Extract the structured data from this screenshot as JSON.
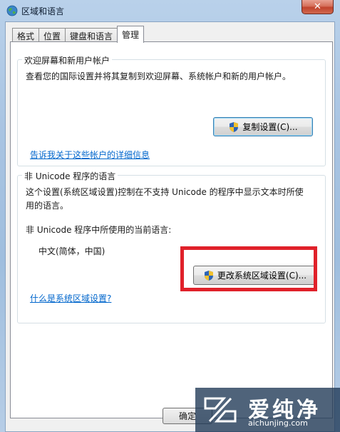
{
  "window": {
    "title": "区域和语言",
    "close_label": "✕"
  },
  "tabs": [
    {
      "label": "格式"
    },
    {
      "label": "位置"
    },
    {
      "label": "键盘和语言"
    },
    {
      "label": "管理",
      "active": true
    }
  ],
  "welcome_group": {
    "title": "欢迎屏幕和新用户帐户",
    "description": "查看您的国际设置并将其复制到欢迎屏幕、系统帐户和新的用户帐户。",
    "copy_button": "复制设置(C)...",
    "link": "告诉我关于这些帐户的详细信息"
  },
  "unicode_group": {
    "title": "非 Unicode 程序的语言",
    "description_line1": "这个设置(系统区域设置)控制在不支持 Unicode 的程序中显示文本时所使",
    "description_line2": "用的语言。",
    "current_label": "非 Unicode 程序中所使用的当前语言:",
    "current_value": "中文(简体，中国)",
    "change_button": "更改系统区域设置(C)...",
    "link": "什么是系统区域设置?"
  },
  "footer": {
    "ok_button": "确定"
  },
  "watermark": {
    "title": "爱纯净",
    "url": "aichunjing.com"
  },
  "colors": {
    "highlight": "#e0212a",
    "link": "#0066cc"
  }
}
